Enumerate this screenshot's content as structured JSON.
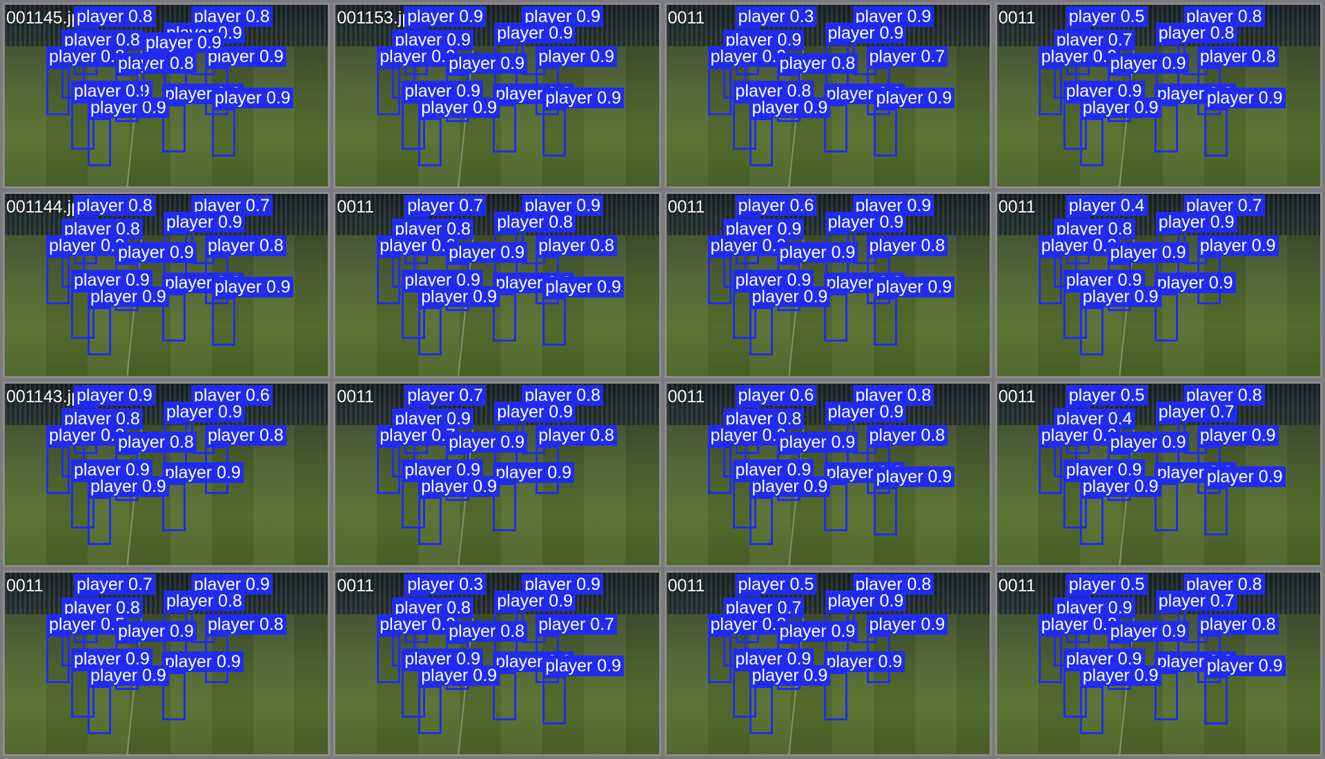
{
  "window": {
    "title": "Batch detection previews"
  },
  "colors": {
    "box": "#1f2cf0",
    "label_text": "#ffffff",
    "frame": "#8c8c8c",
    "background": "#7b7b7b"
  },
  "tiles": [
    {
      "filename": "001145.jpg",
      "detections": [
        {
          "label": "player",
          "conf": "0.8"
        },
        {
          "label": "player",
          "conf": "0.8"
        },
        {
          "label": "player",
          "conf": "0.8"
        },
        {
          "label": "player",
          "conf": "0.9"
        },
        {
          "label": "player",
          "conf": "0.8"
        },
        {
          "label": "player",
          "conf": "0.9"
        },
        {
          "label": "player",
          "conf": "0.8"
        },
        {
          "label": "player",
          "conf": "0.9"
        },
        {
          "label": "player",
          "conf": "0.9"
        },
        {
          "label": "player",
          "conf": "0.9"
        },
        {
          "label": "player",
          "conf": "0.9"
        },
        {
          "label": "player",
          "conf": "0.9"
        }
      ]
    },
    {
      "filename": "001153.jpg",
      "detections": [
        {
          "label": "player",
          "conf": "0.9"
        },
        {
          "label": "player",
          "conf": "0.9"
        },
        {
          "label": "player",
          "conf": "0.9"
        },
        {
          "label": "player",
          "conf": "0.9"
        },
        {
          "label": "player",
          "conf": "0.9"
        },
        {
          "label": "player",
          "conf": "0.9"
        },
        {
          "label": "player",
          "conf": "0.9"
        },
        {
          "label": "player",
          "conf": "0.9"
        },
        {
          "label": "player",
          "conf": "0.9"
        },
        {
          "label": "player",
          "conf": "0.9"
        },
        {
          "label": "player",
          "conf": "0.9"
        }
      ]
    },
    {
      "filename": "0011",
      "detections": [
        {
          "label": "player",
          "conf": "0.3"
        },
        {
          "label": "player",
          "conf": "0.9"
        },
        {
          "label": "player",
          "conf": "0.9"
        },
        {
          "label": "player",
          "conf": "0.9"
        },
        {
          "label": "player",
          "conf": "0.9"
        },
        {
          "label": "player",
          "conf": "0.7"
        },
        {
          "label": "player",
          "conf": "0.8"
        },
        {
          "label": "player",
          "conf": "0.8"
        },
        {
          "label": "player",
          "conf": "0.9"
        },
        {
          "label": "player",
          "conf": "0.9"
        },
        {
          "label": "player",
          "conf": "0.9"
        }
      ]
    },
    {
      "filename": "0011",
      "detections": [
        {
          "label": "player",
          "conf": "0.5"
        },
        {
          "label": "player",
          "conf": "0.8"
        },
        {
          "label": "player",
          "conf": "0.7"
        },
        {
          "label": "player",
          "conf": "0.8"
        },
        {
          "label": "player",
          "conf": "0.9"
        },
        {
          "label": "player",
          "conf": "0.8"
        },
        {
          "label": "player",
          "conf": "0.9"
        },
        {
          "label": "player",
          "conf": "0.9"
        },
        {
          "label": "player",
          "conf": "0.9"
        },
        {
          "label": "player",
          "conf": "0.9"
        },
        {
          "label": "player",
          "conf": "0.9"
        }
      ]
    },
    {
      "filename": "001144.jpg",
      "detections": [
        {
          "label": "player",
          "conf": "0.8"
        },
        {
          "label": "player",
          "conf": "0.7"
        },
        {
          "label": "player",
          "conf": "0.8"
        },
        {
          "label": "player",
          "conf": "0.9"
        },
        {
          "label": "player",
          "conf": "0.9"
        },
        {
          "label": "player",
          "conf": "0.8"
        },
        {
          "label": "player",
          "conf": "0.9"
        },
        {
          "label": "player",
          "conf": "0.9"
        },
        {
          "label": "player",
          "conf": "0.9"
        },
        {
          "label": "player",
          "conf": "0.9"
        },
        {
          "label": "player",
          "conf": "0.9"
        }
      ]
    },
    {
      "filename": "0011",
      "detections": [
        {
          "label": "player",
          "conf": "0.7"
        },
        {
          "label": "player",
          "conf": "0.9"
        },
        {
          "label": "player",
          "conf": "0.8"
        },
        {
          "label": "player",
          "conf": "0.8"
        },
        {
          "label": "player",
          "conf": "0.6"
        },
        {
          "label": "player",
          "conf": "0.8"
        },
        {
          "label": "player",
          "conf": "0.9"
        },
        {
          "label": "player",
          "conf": "0.9"
        },
        {
          "label": "player",
          "conf": "0.9"
        },
        {
          "label": "player",
          "conf": "0.9"
        },
        {
          "label": "player",
          "conf": "0.9"
        }
      ]
    },
    {
      "filename": "0011",
      "detections": [
        {
          "label": "player",
          "conf": "0.6"
        },
        {
          "label": "player",
          "conf": "0.9"
        },
        {
          "label": "player",
          "conf": "0.9"
        },
        {
          "label": "player",
          "conf": "0.9"
        },
        {
          "label": "player",
          "conf": "0.9"
        },
        {
          "label": "player",
          "conf": "0.8"
        },
        {
          "label": "player",
          "conf": "0.9"
        },
        {
          "label": "player",
          "conf": "0.9"
        },
        {
          "label": "player",
          "conf": "0.9"
        },
        {
          "label": "player",
          "conf": "0.9"
        },
        {
          "label": "player",
          "conf": "0.9"
        }
      ]
    },
    {
      "filename": "0011",
      "detections": [
        {
          "label": "player",
          "conf": "0.4"
        },
        {
          "label": "player",
          "conf": "0.7"
        },
        {
          "label": "player",
          "conf": "0.8"
        },
        {
          "label": "player",
          "conf": "0.9"
        },
        {
          "label": "player",
          "conf": "0.9"
        },
        {
          "label": "player",
          "conf": "0.9"
        },
        {
          "label": "player",
          "conf": "0.9"
        },
        {
          "label": "player",
          "conf": "0.9"
        },
        {
          "label": "player",
          "conf": "0.9"
        },
        {
          "label": "player",
          "conf": "0.9"
        }
      ]
    },
    {
      "filename": "001143.jpg",
      "detections": [
        {
          "label": "player",
          "conf": "0.9"
        },
        {
          "label": "player",
          "conf": "0.6"
        },
        {
          "label": "player",
          "conf": "0.8"
        },
        {
          "label": "player",
          "conf": "0.9"
        },
        {
          "label": "player",
          "conf": "0.3"
        },
        {
          "label": "player",
          "conf": "0.8"
        },
        {
          "label": "player",
          "conf": "0.8"
        },
        {
          "label": "player",
          "conf": "0.9"
        },
        {
          "label": "player",
          "conf": "0.9"
        },
        {
          "label": "player",
          "conf": "0.9"
        }
      ]
    },
    {
      "filename": "0011",
      "detections": [
        {
          "label": "player",
          "conf": "0.7"
        },
        {
          "label": "player",
          "conf": "0.8"
        },
        {
          "label": "player",
          "conf": "0.9"
        },
        {
          "label": "player",
          "conf": "0.9"
        },
        {
          "label": "player",
          "conf": "0.7"
        },
        {
          "label": "player",
          "conf": "0.8"
        },
        {
          "label": "player",
          "conf": "0.9"
        },
        {
          "label": "player",
          "conf": "0.9"
        },
        {
          "label": "player",
          "conf": "0.9"
        },
        {
          "label": "player",
          "conf": "0.9"
        }
      ]
    },
    {
      "filename": "0011",
      "detections": [
        {
          "label": "player",
          "conf": "0.6"
        },
        {
          "label": "player",
          "conf": "0.8"
        },
        {
          "label": "player",
          "conf": "0.8"
        },
        {
          "label": "player",
          "conf": "0.9"
        },
        {
          "label": "player",
          "conf": "0.9"
        },
        {
          "label": "player",
          "conf": "0.8"
        },
        {
          "label": "player",
          "conf": "0.9"
        },
        {
          "label": "player",
          "conf": "0.9"
        },
        {
          "label": "player",
          "conf": "0.9"
        },
        {
          "label": "player",
          "conf": "0.9"
        },
        {
          "label": "player",
          "conf": "0.9"
        }
      ]
    },
    {
      "filename": "0011",
      "detections": [
        {
          "label": "player",
          "conf": "0.5"
        },
        {
          "label": "player",
          "conf": "0.8"
        },
        {
          "label": "player",
          "conf": "0.4"
        },
        {
          "label": "player",
          "conf": "0.7"
        },
        {
          "label": "player",
          "conf": "0.9"
        },
        {
          "label": "player",
          "conf": "0.9"
        },
        {
          "label": "player",
          "conf": "0.9"
        },
        {
          "label": "player",
          "conf": "0.9"
        },
        {
          "label": "player",
          "conf": "0.9"
        },
        {
          "label": "player",
          "conf": "0.9"
        },
        {
          "label": "player",
          "conf": "0.9"
        }
      ]
    },
    {
      "filename": "0011",
      "detections": [
        {
          "label": "player",
          "conf": "0.7"
        },
        {
          "label": "player",
          "conf": "0.9"
        },
        {
          "label": "player",
          "conf": "0.8"
        },
        {
          "label": "player",
          "conf": "0.8"
        },
        {
          "label": "player",
          "conf": "0.5"
        },
        {
          "label": "player",
          "conf": "0.8"
        },
        {
          "label": "player",
          "conf": "0.9"
        },
        {
          "label": "player",
          "conf": "0.9"
        },
        {
          "label": "player",
          "conf": "0.9"
        },
        {
          "label": "player",
          "conf": "0.9"
        }
      ]
    },
    {
      "filename": "0011",
      "detections": [
        {
          "label": "player",
          "conf": "0.3"
        },
        {
          "label": "player",
          "conf": "0.9"
        },
        {
          "label": "player",
          "conf": "0.8"
        },
        {
          "label": "player",
          "conf": "0.9"
        },
        {
          "label": "player",
          "conf": "0.8"
        },
        {
          "label": "player",
          "conf": "0.7"
        },
        {
          "label": "player",
          "conf": "0.8"
        },
        {
          "label": "player",
          "conf": "0.9"
        },
        {
          "label": "player",
          "conf": "0.9"
        },
        {
          "label": "player",
          "conf": "0.9"
        },
        {
          "label": "player",
          "conf": "0.9"
        }
      ]
    },
    {
      "filename": "0011",
      "detections": [
        {
          "label": "player",
          "conf": "0.5"
        },
        {
          "label": "player",
          "conf": "0.8"
        },
        {
          "label": "player",
          "conf": "0.7"
        },
        {
          "label": "player",
          "conf": "0.9"
        },
        {
          "label": "player",
          "conf": "0.8"
        },
        {
          "label": "player",
          "conf": "0.9"
        },
        {
          "label": "player",
          "conf": "0.9"
        },
        {
          "label": "player",
          "conf": "0.9"
        },
        {
          "label": "player",
          "conf": "0.9"
        },
        {
          "label": "player",
          "conf": "0.9"
        }
      ]
    },
    {
      "filename": "0011",
      "detections": [
        {
          "label": "player",
          "conf": "0.5"
        },
        {
          "label": "player",
          "conf": "0.8"
        },
        {
          "label": "player",
          "conf": "0.9"
        },
        {
          "label": "player",
          "conf": "0.7"
        },
        {
          "label": "player",
          "conf": "0.8"
        },
        {
          "label": "player",
          "conf": "0.8"
        },
        {
          "label": "player",
          "conf": "0.9"
        },
        {
          "label": "player",
          "conf": "0.9"
        },
        {
          "label": "player",
          "conf": "0.9"
        },
        {
          "label": "player",
          "conf": "0.9"
        },
        {
          "label": "player",
          "conf": "0.9"
        }
      ]
    }
  ]
}
